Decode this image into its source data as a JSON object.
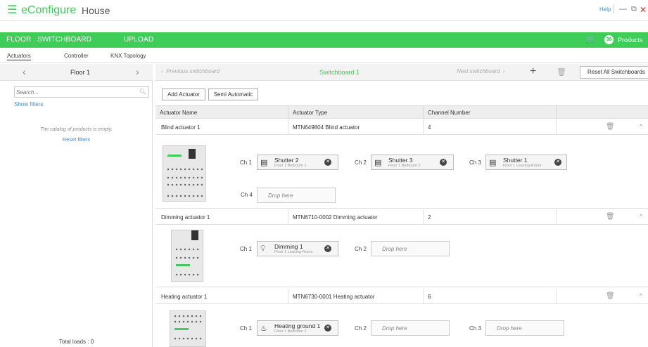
{
  "app": {
    "name": "eConfigure",
    "project": "House",
    "help": "Help",
    "menu_icon": "hamburger-icon",
    "window_controls": {
      "minimize": "—",
      "restore": "⧉",
      "close": "✕"
    }
  },
  "mainnav": {
    "floor": "FLOOR",
    "switchboard": "SWITCHBOARD",
    "upload": "UPLOAD"
  },
  "cart": {
    "count": "30",
    "products_label": "Products",
    "icon": "cart-icon"
  },
  "subnav": {
    "actuators": "Actuators",
    "controller": "Controller",
    "knx_topology": "KNX Topology"
  },
  "left": {
    "floor_name": "Floor 1",
    "search_placeholder": "Search...",
    "show_filters": "Show filters",
    "empty_message": "The catalog of products is empty.",
    "reset_filters": "Reset filters",
    "total_loads": "Total loads : 0"
  },
  "switchboard": {
    "prev": "Previous switchboard",
    "current": "Switchboard 1",
    "next": "Next switchboard",
    "reset_all": "Reset All Switchboards"
  },
  "toolbar": {
    "add_actuator": "Add Actuator",
    "semi_automatic": "Semi Automatic"
  },
  "table": {
    "headers": [
      "Actuator Name",
      "Actuator Type",
      "Channel Number"
    ],
    "rows": [
      {
        "name": "Blind actuator 1",
        "type": "MTN649804 Blind actuator",
        "channels": "4",
        "slots": [
          {
            "ch": "Ch 1",
            "name": "Shutter 2",
            "sub": "Floor 1 Bedroom 1",
            "icon": "shutter-icon"
          },
          {
            "ch": "Ch 2",
            "name": "Shutter 3",
            "sub": "Floor 1 Bedroom 2",
            "icon": "shutter-icon"
          },
          {
            "ch": "Ch 3",
            "name": "Shutter 1",
            "sub": "Floor 1 Leaving-Room",
            "icon": "shutter-icon"
          },
          {
            "ch": "Ch 4",
            "drop": "Drop here"
          }
        ]
      },
      {
        "name": "Dimming actuator 1",
        "type": "MTN6710-0002 Dimming actuator",
        "channels": "2",
        "slots": [
          {
            "ch": "Ch 1",
            "name": "Dimming 1",
            "sub": "Floor 1 Leaving-Room",
            "icon": "bulb-icon"
          },
          {
            "ch": "Ch 2",
            "drop": "Drop here"
          }
        ]
      },
      {
        "name": "Heating actuator 1",
        "type": "MTN6730-0001 Heating actuator",
        "channels": "6",
        "slots": [
          {
            "ch": "Ch 1",
            "name": "Heating ground 1",
            "sub": "Floor 1 Bedroom 2",
            "icon": "heating-icon"
          },
          {
            "ch": "Ch 2",
            "drop": "Drop here"
          },
          {
            "ch": "Ch 3",
            "drop": "Drop here"
          }
        ]
      }
    ]
  },
  "colors": {
    "accent": "#3dcd58",
    "link": "#3a8fd6",
    "close": "#e0322c"
  }
}
